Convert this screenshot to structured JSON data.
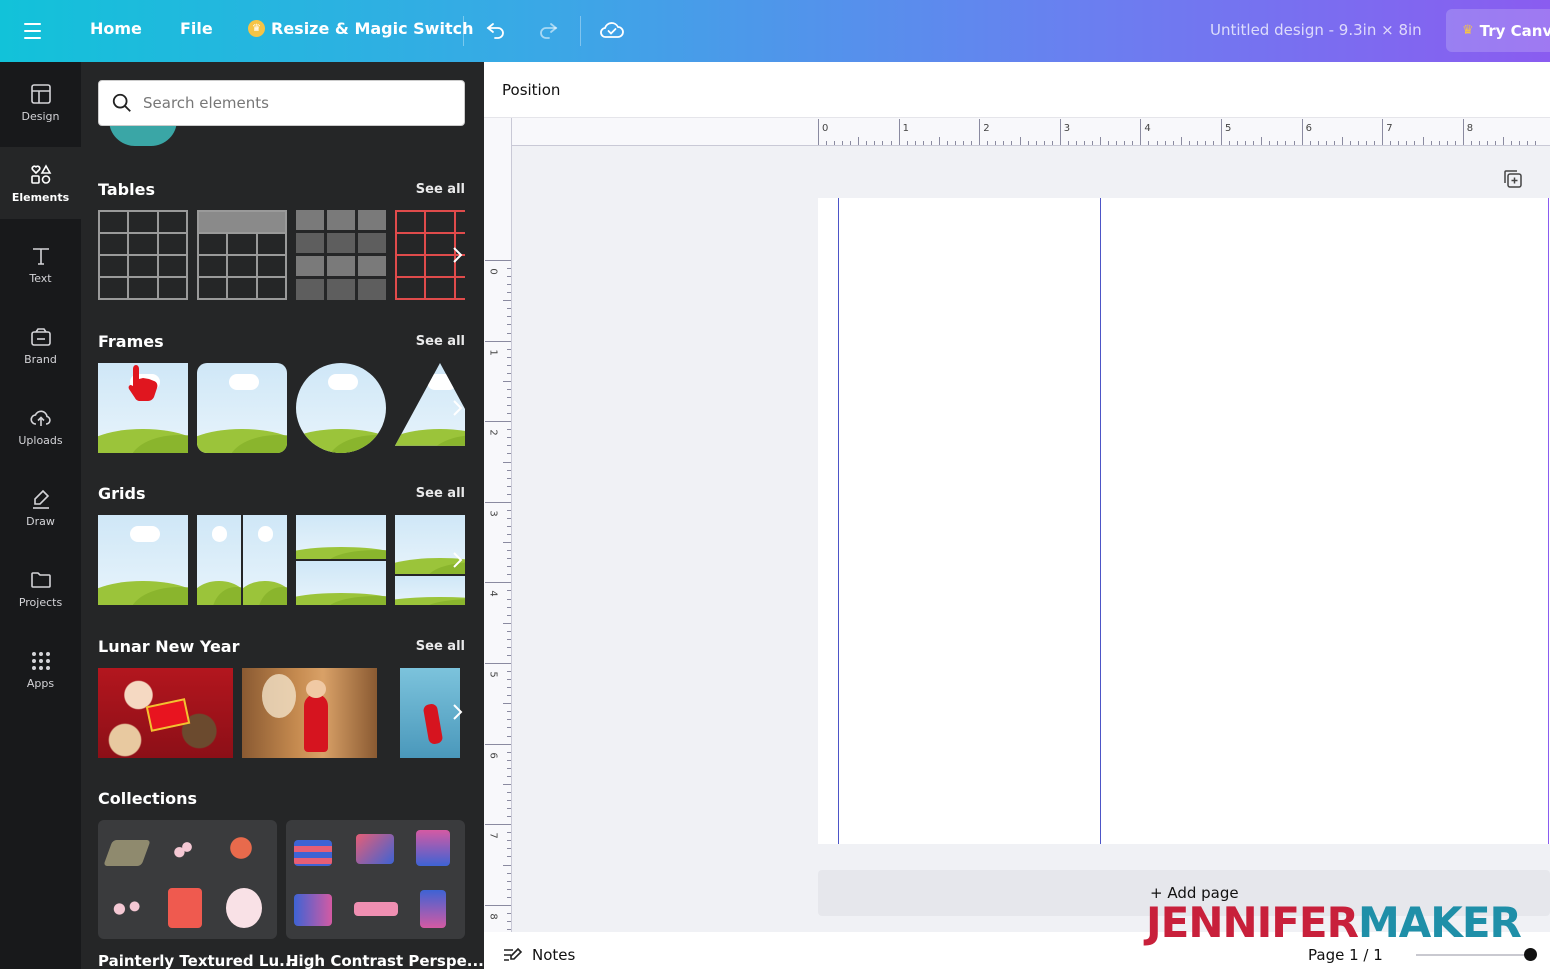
{
  "topbar": {
    "home": "Home",
    "file": "File",
    "resize": "Resize & Magic Switch",
    "title": "Untitled design - 9.3in × 8in",
    "try": "Try Canva Pro"
  },
  "rail": [
    {
      "label": "Design",
      "icon": "design-icon"
    },
    {
      "label": "Elements",
      "icon": "elements-icon"
    },
    {
      "label": "Text",
      "icon": "text-icon"
    },
    {
      "label": "Brand",
      "icon": "brand-icon"
    },
    {
      "label": "Uploads",
      "icon": "uploads-icon"
    },
    {
      "label": "Draw",
      "icon": "draw-icon"
    },
    {
      "label": "Projects",
      "icon": "projects-icon"
    },
    {
      "label": "Apps",
      "icon": "apps-icon"
    }
  ],
  "panel": {
    "search_placeholder": "Search elements",
    "sections": [
      {
        "title": "Tables",
        "see_all": "See all"
      },
      {
        "title": "Frames",
        "see_all": "See all"
      },
      {
        "title": "Grids",
        "see_all": "See all"
      },
      {
        "title": "Lunar New Year",
        "see_all": "See all"
      },
      {
        "title": "Collections"
      }
    ],
    "collections": [
      "Painterly Textured Lu...",
      "High Contrast Perspe..."
    ]
  },
  "editor": {
    "position": "Position",
    "ruler_h": [
      "0",
      "1",
      "2",
      "3",
      "4",
      "5",
      "6",
      "7",
      "8"
    ],
    "ruler_v": [
      "0",
      "1",
      "2",
      "3",
      "4",
      "5",
      "6",
      "7",
      "8"
    ],
    "add_page": "+ Add page",
    "notes": "Notes",
    "page_count": "Page 1 / 1"
  },
  "watermark": {
    "part1": "JENNIFER",
    "part2": "MAKER"
  },
  "colors": {
    "accent_teal": "#12c2d9",
    "accent_purple": "#8a5cf0",
    "panel": "#252627",
    "rail": "#18191b",
    "guide": "#4d55c7"
  }
}
